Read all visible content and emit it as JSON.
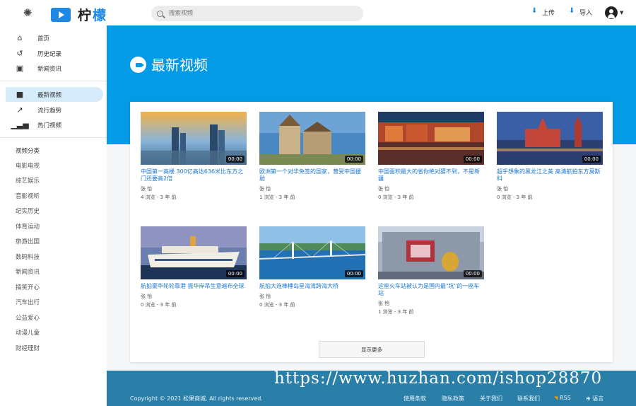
{
  "header": {
    "logo_text_1": "柠",
    "logo_text_2": "檬",
    "search_placeholder": "搜索视频",
    "upload_label": "上传",
    "import_label": "导入"
  },
  "sidebar": {
    "primary": [
      {
        "label": "首页",
        "icon": "home-icon"
      },
      {
        "label": "历史纪录",
        "icon": "history-icon"
      },
      {
        "label": "新闻资讯",
        "icon": "news-icon"
      }
    ],
    "secondary": [
      {
        "label": "最新视频",
        "icon": "video-camera-icon",
        "active": true
      },
      {
        "label": "流行趋势",
        "icon": "trending-icon"
      },
      {
        "label": "热门视频",
        "icon": "bar-chart-icon"
      }
    ],
    "categories_title": "视频分类",
    "categories": [
      "电影电视",
      "综艺娱乐",
      "音影视听",
      "纪实历史",
      "体育运动",
      "旅游出国",
      "数码科技",
      "新闻资讯",
      "搞笑开心",
      "汽车出行",
      "公益爱心",
      "动漫儿童",
      "财经理财"
    ]
  },
  "main": {
    "page_title": "最新视频",
    "show_more": "显示更多",
    "videos": [
      {
        "title": "中国第一高楼 300亿高达636米比东方之门还要高2倍",
        "author": "张 怡",
        "meta": "4 浏览 - 3 年 前",
        "duration": "00:00"
      },
      {
        "title": "欧洲第一个对华免签的国家，曾受中国援助",
        "author": "张 怡",
        "meta": "1 浏览 - 3 年 前",
        "duration": "00:00"
      },
      {
        "title": "中国面积最大的省你绝对猜不到，不是新疆",
        "author": "张 怡",
        "meta": "0 浏览 - 3 年 前",
        "duration": "00:00"
      },
      {
        "title": "超乎想象的黑龙江之美 高清航拍东方莫斯科",
        "author": "张 怡",
        "meta": "0 浏览 - 3 年 前",
        "duration": "00:00"
      },
      {
        "title": "航拍豪华轮轮靠港 振华岸吊生意遍布全球",
        "author": "张 怡",
        "meta": "0 浏览 - 3 年 前",
        "duration": "00:00"
      },
      {
        "title": "航拍大连棒棰岛星海湾跨海大桥",
        "author": "张 怡",
        "meta": "0 浏览 - 3 年 前",
        "duration": "00:00"
      },
      {
        "title": "这座火车站被认为是国内最\"坑\"的一座车站",
        "author": "张 怡",
        "meta": "1 浏览 - 3 年 前",
        "duration": "00:00"
      }
    ]
  },
  "footer": {
    "copyright": "Copyright © 2021 松果商城. All rights reserved.",
    "links": [
      "使用条款",
      "隐私政策",
      "关于我们",
      "联系我们",
      "RSS",
      "语言"
    ],
    "watermark": "https://www.huzhan.com/ishop28870"
  },
  "colors": {
    "brand_blue": "#1e88e5",
    "banner_blue": "#039be5",
    "footer_blue": "#2a7fa8",
    "active_bg": "#d6ecfb"
  }
}
